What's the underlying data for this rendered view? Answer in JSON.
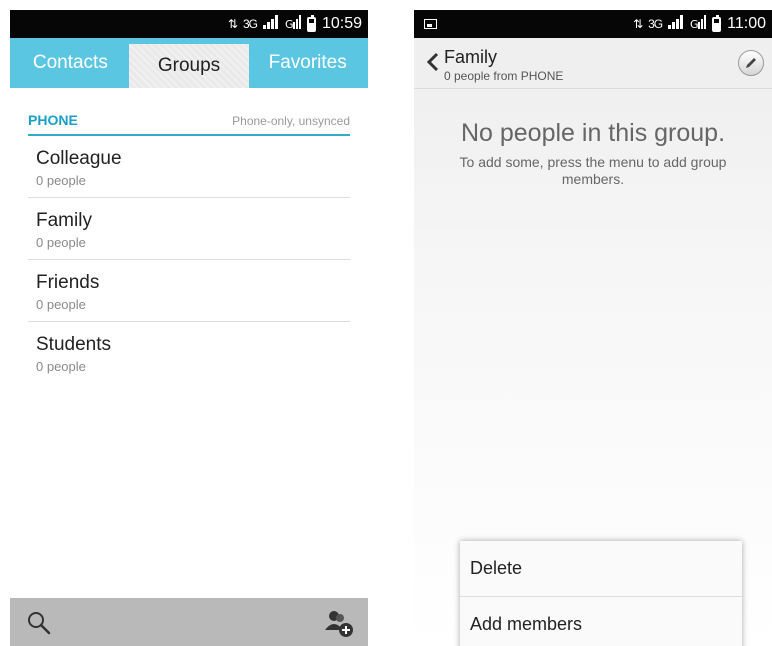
{
  "left": {
    "status": {
      "network": "3G",
      "time": "10:59"
    },
    "tabs": [
      "Contacts",
      "Groups",
      "Favorites"
    ],
    "active_tab": "Groups",
    "section": {
      "title": "PHONE",
      "subtitle": "Phone-only, unsynced"
    },
    "groups": [
      {
        "name": "Colleague",
        "count": "0 people"
      },
      {
        "name": "Family",
        "count": "0 people"
      },
      {
        "name": "Friends",
        "count": "0 people"
      },
      {
        "name": "Students",
        "count": "0 people"
      }
    ],
    "bottom_icons": [
      "search-icon",
      "add-group-icon"
    ]
  },
  "right": {
    "status": {
      "network": "3G",
      "time": "11:00"
    },
    "title": "Family",
    "subtitle": "0 people from PHONE",
    "empty_title": "No people in this group.",
    "empty_message": "To add some, press the menu to add group members.",
    "menu": [
      "Delete",
      "Add members"
    ]
  },
  "colors": {
    "accent": "#5bc6e2",
    "section_blue": "#1aa0c8",
    "statusbar": "#060606",
    "bottombar": "#b9b9b9"
  }
}
